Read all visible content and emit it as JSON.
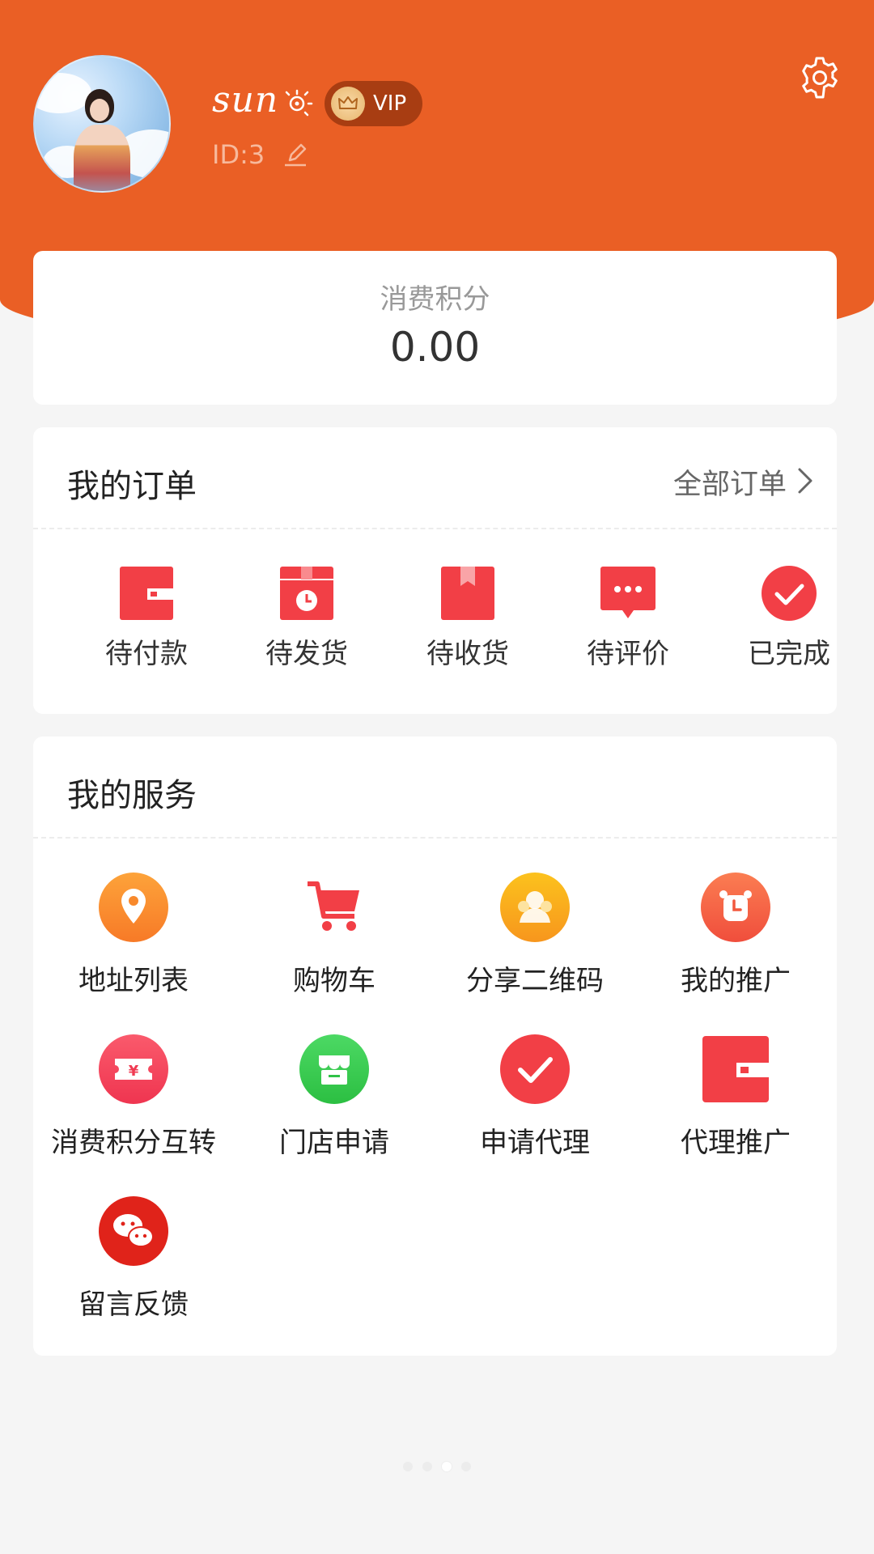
{
  "colors": {
    "brand_orange": "#ea5f25",
    "icon_red": "#f23f46",
    "background": "#f5f5f5"
  },
  "profile": {
    "username": "sun",
    "vip_label": "VIP",
    "user_id": "ID:3"
  },
  "points": {
    "label": "消费积分",
    "value": "0.00"
  },
  "orders": {
    "title": "我的订单",
    "all_orders_label": "全部订单",
    "items": [
      {
        "label": "待付款",
        "icon": "wallet-icon"
      },
      {
        "label": "待发货",
        "icon": "box-clock-icon"
      },
      {
        "label": "待收货",
        "icon": "package-icon"
      },
      {
        "label": "待评价",
        "icon": "chat-bubble-icon"
      },
      {
        "label": "已完成",
        "icon": "check-circle-icon"
      }
    ]
  },
  "services": {
    "title": "我的服务",
    "items": [
      {
        "label": "地址列表",
        "icon": "location-pin-icon"
      },
      {
        "label": "购物车",
        "icon": "shopping-cart-icon"
      },
      {
        "label": "分享二维码",
        "icon": "share-icon"
      },
      {
        "label": "我的推广",
        "icon": "alarm-clock-icon"
      },
      {
        "label": "消费积分互转",
        "icon": "yuan-ticket-icon"
      },
      {
        "label": "门店申请",
        "icon": "store-icon"
      },
      {
        "label": "申请代理",
        "icon": "check-circle-icon"
      },
      {
        "label": "代理推广",
        "icon": "wallet-icon"
      },
      {
        "label": "留言反馈",
        "icon": "wechat-icon"
      }
    ]
  }
}
